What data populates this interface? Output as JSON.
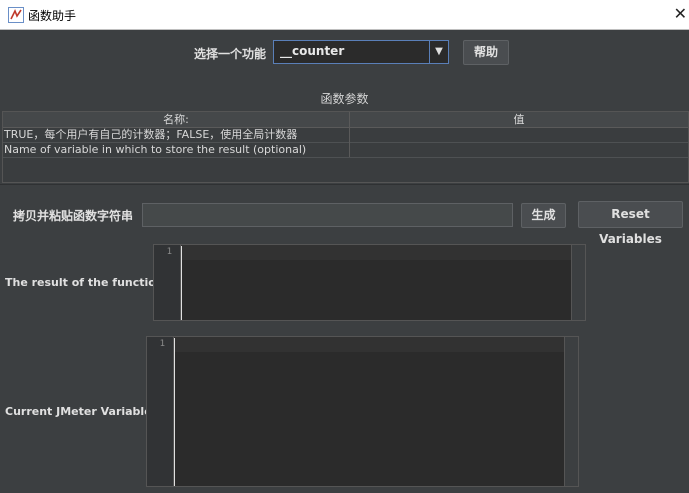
{
  "window": {
    "title": "函数助手",
    "close_symbol": "✕"
  },
  "function_select": {
    "label": "选择一个功能",
    "value": "__counter",
    "arrow": "▼",
    "help_label": "帮助"
  },
  "params": {
    "section_title": "函数参数",
    "col_name": "名称:",
    "col_value": "值",
    "rows": [
      {
        "name": "TRUE，每个用户有自己的计数器；FALSE，使用全局计数器",
        "value": ""
      },
      {
        "name": "Name of variable in which to store the result (optional)",
        "value": ""
      }
    ]
  },
  "copy_row": {
    "label": "拷贝并粘贴函数字符串",
    "generate_label": "生成",
    "reset_label": "Reset Variables",
    "value": ""
  },
  "result": {
    "label": "The result of the function is",
    "line_number": "1"
  },
  "variables": {
    "label": "Current JMeter Variables",
    "line_number": "1"
  }
}
